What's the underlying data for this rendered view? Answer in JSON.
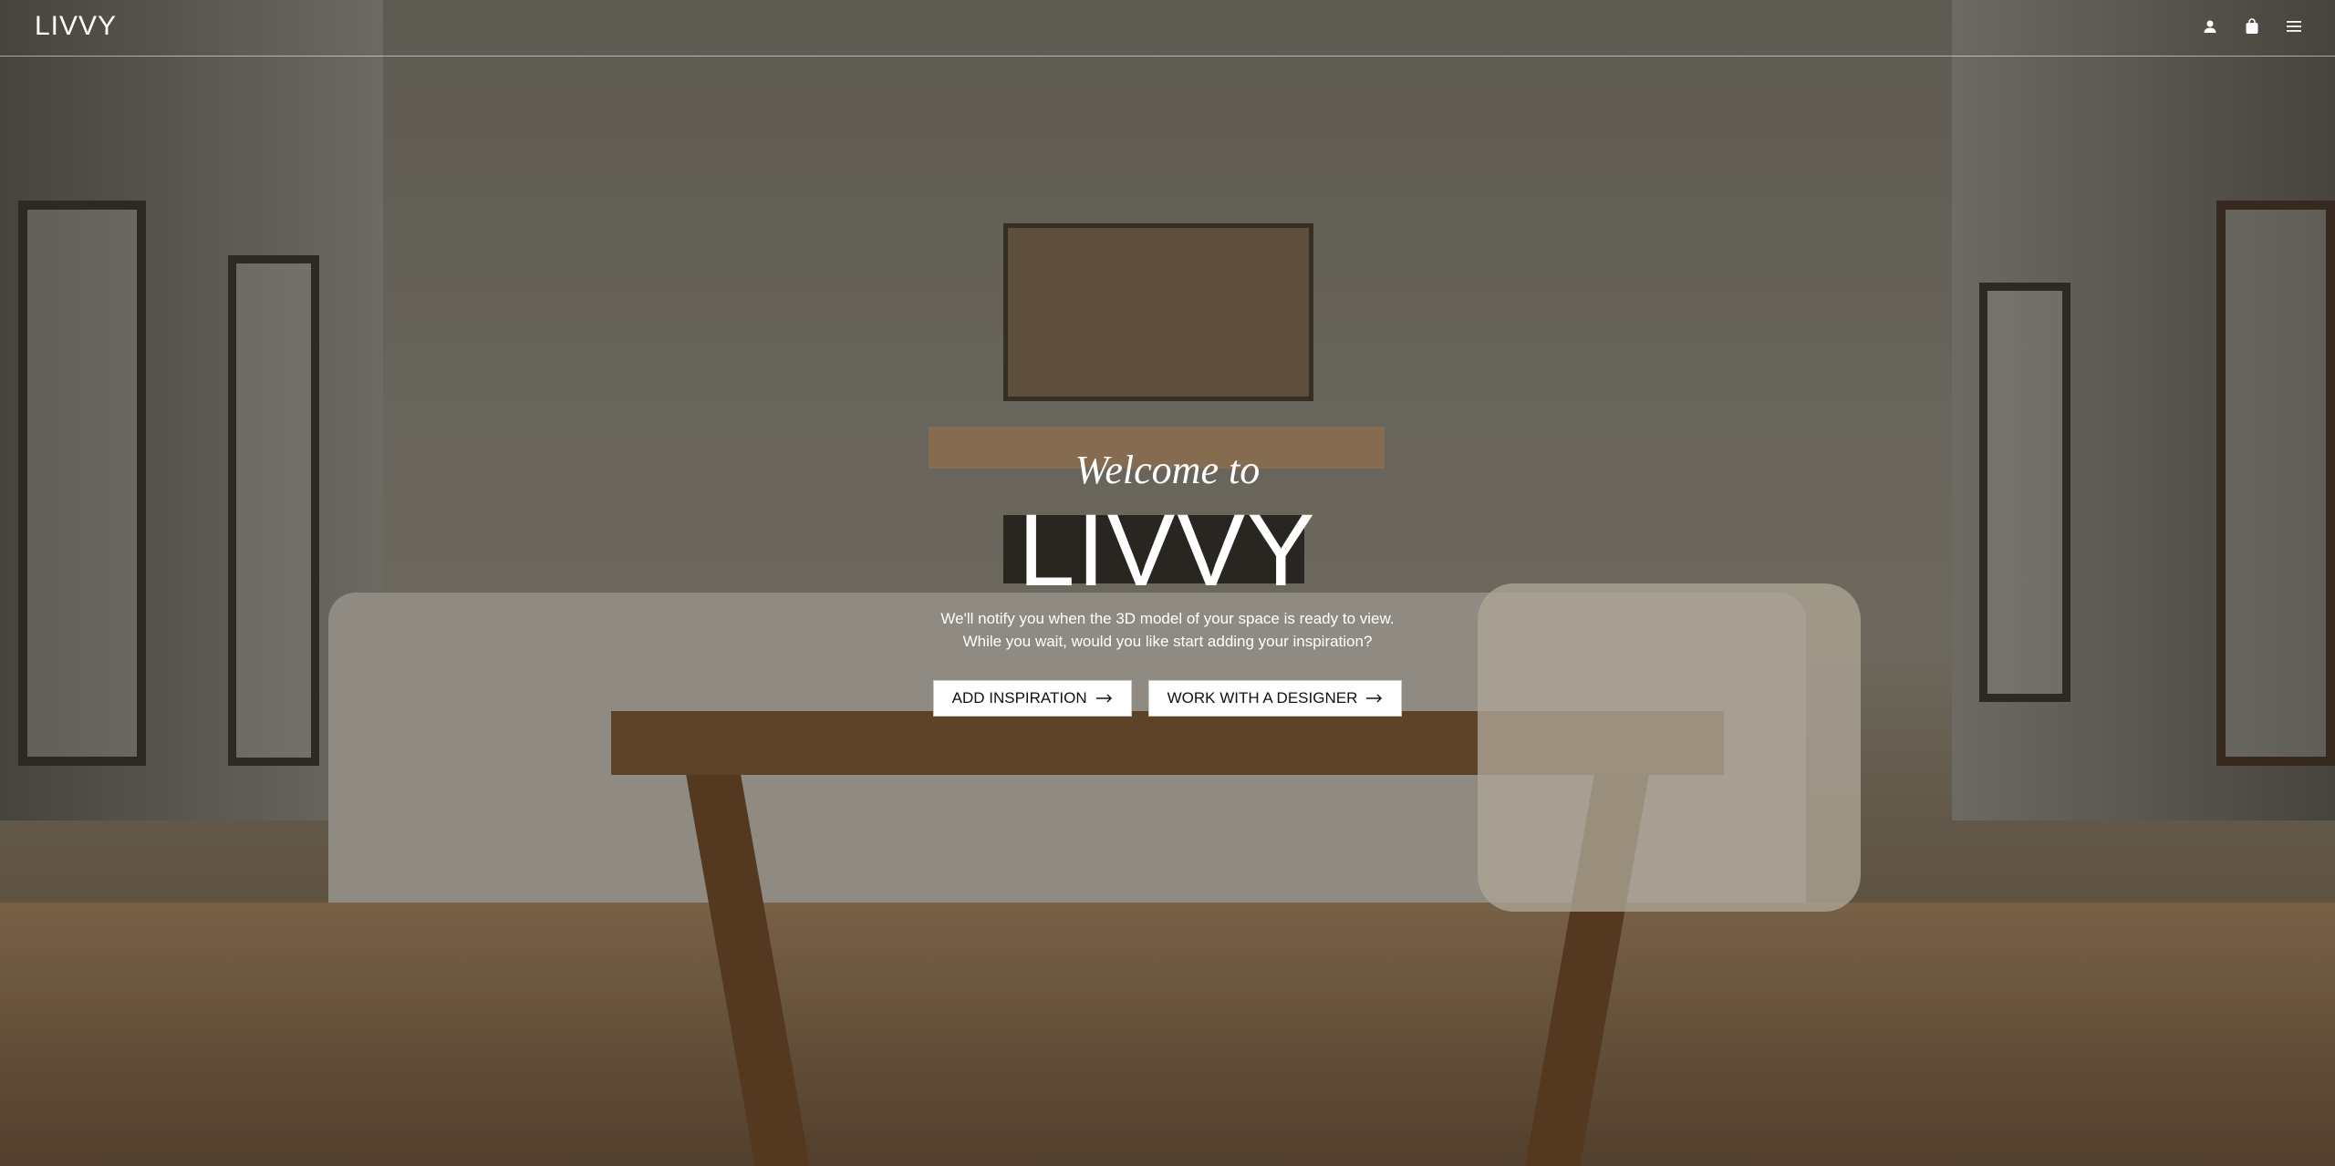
{
  "header": {
    "logo": "LIVVY",
    "icons": [
      "user-icon",
      "shopping-bag-icon",
      "menu-icon"
    ]
  },
  "hero": {
    "welcome": "Welcome to",
    "brand": "LIVVY",
    "subtext": "We'll notify you when the 3D model of your space is ready to view. While you wait, would you like start adding your inspiration?",
    "buttons": [
      {
        "label": "ADD INSPIRATION",
        "icon": "arrow-right-icon"
      },
      {
        "label": "WORK WITH A DESIGNER",
        "icon": "arrow-right-icon"
      }
    ]
  },
  "colors": {
    "text": "#ffffff",
    "button_bg": "#ffffff",
    "button_text": "#111111"
  }
}
